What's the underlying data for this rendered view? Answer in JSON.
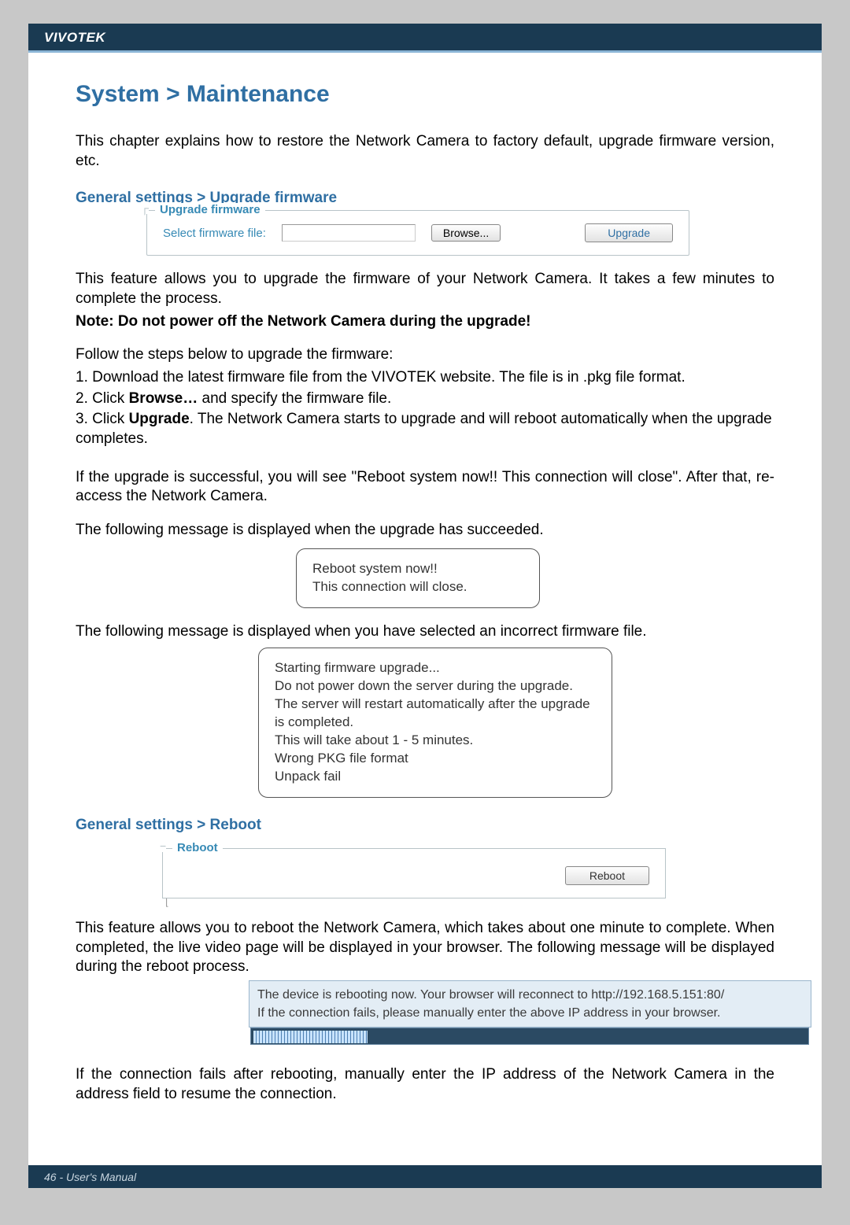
{
  "header": {
    "brand": "VIVOTEK"
  },
  "title": "System > Maintenance",
  "intro": "This chapter explains how to restore the Network Camera to factory default, upgrade firmware version, etc.",
  "upgrade": {
    "heading": "General settings > Upgrade firmware",
    "legend": "Upgrade firmware",
    "label": "Select firmware file:",
    "browse_button": "Browse...",
    "upgrade_button": "Upgrade",
    "desc1": "This feature allows you to upgrade the firmware of your Network Camera. It takes a few minutes to complete the process.",
    "note": "Note: Do not power off the Network Camera during the upgrade!",
    "steps_intro": "Follow the steps below to upgrade the firmware:",
    "step1": "1. Download the latest firmware file from the VIVOTEK website. The file is in .pkg file format.",
    "step2_pre": "2. Click ",
    "step2_bold": "Browse…",
    "step2_post": " and specify the firmware file.",
    "step3_pre": "3. Click ",
    "step3_bold": "Upgrade",
    "step3_post": ". The Network Camera starts to upgrade and will reboot automatically when the upgrade completes.",
    "success_text": "If the upgrade is successful, you will see \"Reboot system now!! This connection will close\". After that, re-access the Network Camera.",
    "success_msg_intro": "The following message is displayed when the upgrade has succeeded.",
    "success_msg_line1": "Reboot system now!!",
    "success_msg_line2": "This connection will close.",
    "fail_msg_intro": "The following message is displayed when you have selected an incorrect firmware file.",
    "fail_msg_l1": "Starting firmware upgrade...",
    "fail_msg_l2": "Do not power down the server during the upgrade.",
    "fail_msg_l3": "The server will restart automatically after the upgrade is completed.",
    "fail_msg_l4": "This will take about 1 - 5 minutes.",
    "fail_msg_l5": "Wrong PKG file format",
    "fail_msg_l6": "Unpack fail"
  },
  "reboot": {
    "heading": "General settings > Reboot",
    "legend": "Reboot",
    "button": "Reboot",
    "desc": "This feature allows you to reboot the Network Camera, which takes about one minute to complete. When completed, the live video page will be displayed in your browser. The following message will be displayed during the reboot process.",
    "msg_line1_pre": "The device is rebooting now. Your browser will reconnect to ",
    "msg_line1_url": "http://192.168.5.151:80/",
    "msg_line2": "If the connection fails, please manually enter the above IP address in your browser.",
    "after": "If the connection fails after rebooting, manually enter the IP address of the Network Camera in the address field to resume the connection."
  },
  "footer": {
    "page": "46 - User's Manual"
  }
}
